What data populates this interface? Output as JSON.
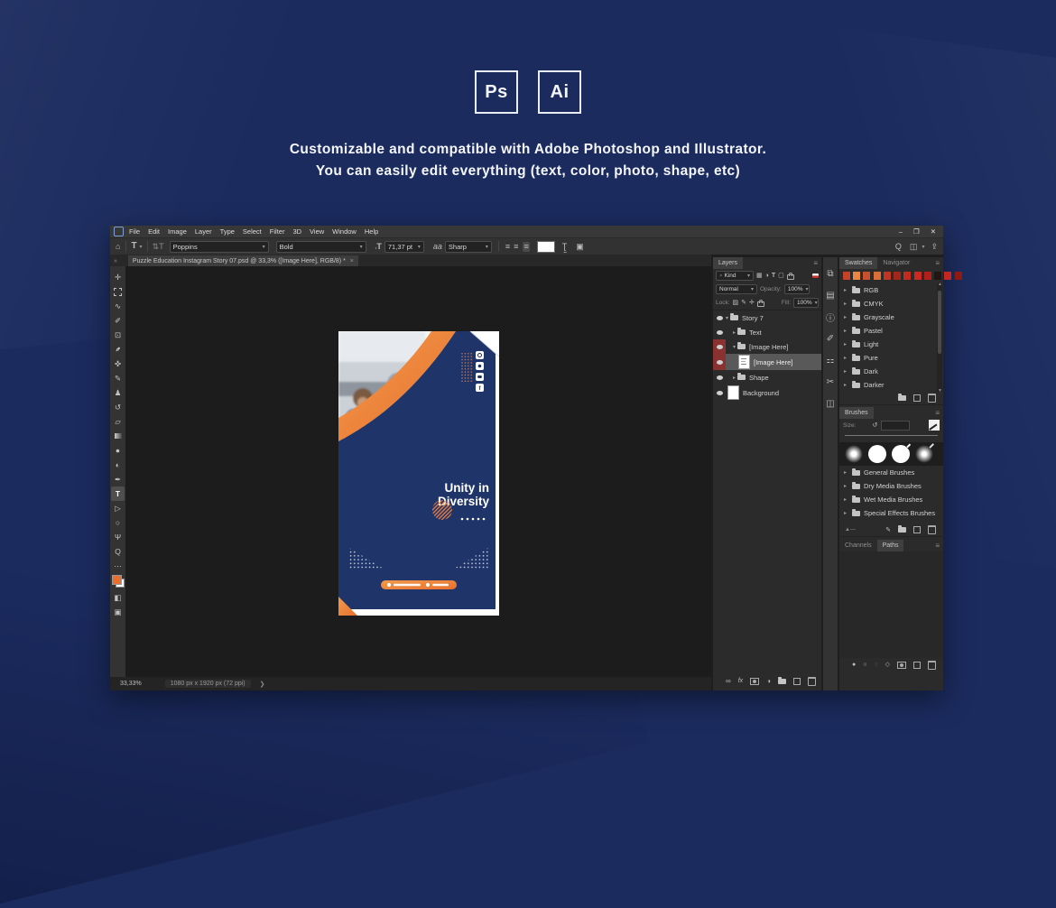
{
  "page": {
    "bg": "#1b2b5e"
  },
  "hero": {
    "ps_badge": "Ps",
    "ai_badge": "Ai",
    "headline_line1": "Customizable and compatible with Adobe Photoshop and Illustrator.",
    "headline_line2": "You can easily edit everything (text, color, photo, shape, etc)"
  },
  "ps": {
    "menu_items": [
      "File",
      "Edit",
      "Image",
      "Layer",
      "Type",
      "Select",
      "Filter",
      "3D",
      "View",
      "Window",
      "Help"
    ],
    "options": {
      "font_family": "Poppins",
      "font_style": "Bold",
      "font_size": "71,37 pt",
      "anti_alias_icon": "aa",
      "anti_alias": "Sharp"
    },
    "doc_tab": "Puzzle Education Instagram Story 07.psd @ 33,3% ([Image Here], RGB/8) *",
    "status": {
      "zoom": "33,33%",
      "doc_size": "1080 px x 1920 px (72 ppi)"
    },
    "layers": {
      "tab": "Layers",
      "kind": "Kind",
      "blend_mode": "Normal",
      "opacity_label": "Opacity:",
      "opacity": "100%",
      "lock_label": "Lock:",
      "fill_label": "Fill:",
      "fill": "100%",
      "fx_label": "fx",
      "rows": [
        {
          "name": "Story 7"
        },
        {
          "name": "Text"
        },
        {
          "name": "[Image Here]"
        },
        {
          "name": "[Image Here]"
        },
        {
          "name": "Shape"
        },
        {
          "name": "Background"
        }
      ],
      "red_highlight": "#8a3131"
    },
    "right_tabs": {
      "swatches": "Swatches",
      "navigator": "Navigator",
      "brushes": "Brushes",
      "channels": "Channels",
      "paths": "Paths"
    },
    "swatches": {
      "colors": [
        "#c44227",
        "#e78742",
        "#c8502d",
        "#d96f35",
        "#bf3524",
        "#a32619",
        "#c22b1d",
        "#cc2a20",
        "#b02018",
        "#201612",
        "#c42622",
        "#8f1a14"
      ],
      "groups": [
        "RGB",
        "CMYK",
        "Grayscale",
        "Pastel",
        "Light",
        "Pure",
        "Dark",
        "Darker"
      ]
    },
    "brushes": {
      "size_label": "Size:",
      "groups": [
        "General Brushes",
        "Dry Media Brushes",
        "Wet Media Brushes",
        "Special Effects Brushes"
      ]
    }
  },
  "design": {
    "title_line1": "Unity in",
    "title_line2": "Diversity",
    "navy": "#1f3468",
    "orange": "#ee7f3b",
    "orange_light": "#f29a4b"
  }
}
